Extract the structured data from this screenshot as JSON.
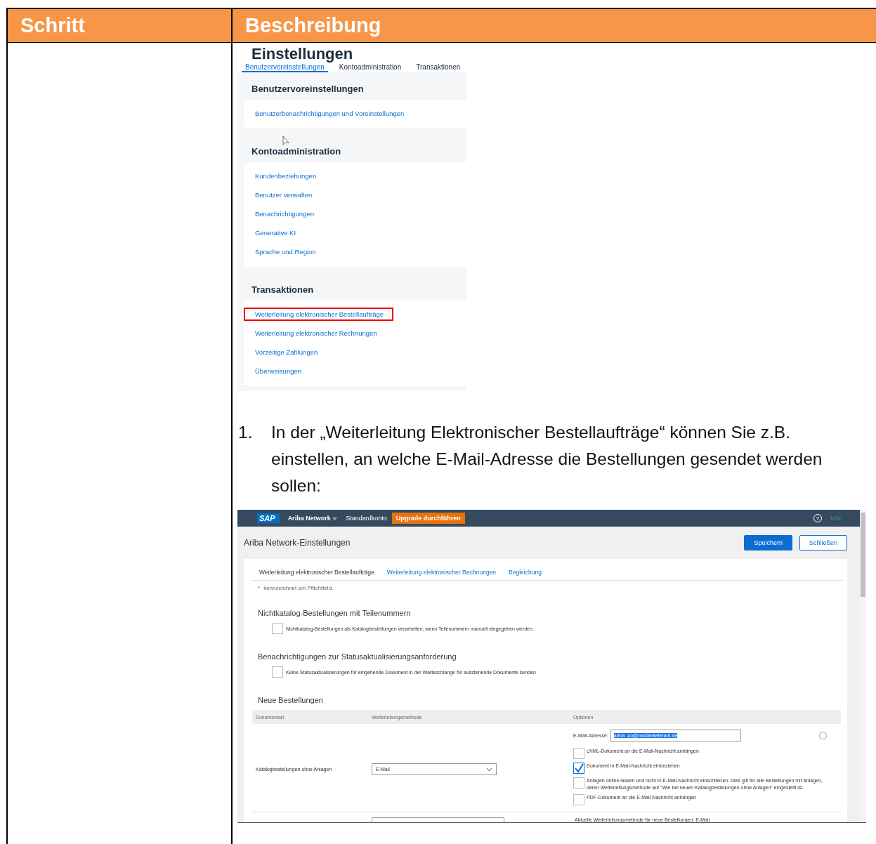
{
  "table": {
    "columns": [
      "Schritt",
      "Beschreibung"
    ]
  },
  "settings_screenshot": {
    "title": "Einstellungen",
    "tabs": [
      {
        "label": "Benutzervoreinstellungen",
        "selected": true
      },
      {
        "label": "Kontoadministration",
        "selected": false
      },
      {
        "label": "Transaktionen",
        "selected": false
      }
    ],
    "sections": [
      {
        "heading": "Benutzervoreinstellungen",
        "links": [
          {
            "label": "Benutzerbenachrichtigungen und Voreinstellungen",
            "highlighted": false
          }
        ]
      },
      {
        "heading": "Kontoadministration",
        "links": [
          {
            "label": "Kundenbeziehungen",
            "highlighted": false
          },
          {
            "label": "Benutzer verwalten",
            "highlighted": false
          },
          {
            "label": "Benachrichtigungen",
            "highlighted": false
          },
          {
            "label": "Generative KI",
            "highlighted": false
          },
          {
            "label": "Sprache und Region",
            "highlighted": false
          }
        ]
      },
      {
        "heading": "Transaktionen",
        "links": [
          {
            "label": "Weiterleitung elektronischer Bestellaufträge",
            "highlighted": true
          },
          {
            "label": "Weiterleitung elektronischer Rechnungen",
            "highlighted": false
          },
          {
            "label": "Vorzeitige Zahlungen",
            "highlighted": false
          },
          {
            "label": "Überweisungen",
            "highlighted": false
          }
        ]
      }
    ]
  },
  "step": {
    "number": "1.",
    "text": "In der „Weiterleitung Elektronischer Bestellaufträge“ können Sie z.B. einstellen, an welche E-Mail-Adresse die Bestellungen gesendet werden sollen:"
  },
  "ariba_screenshot": {
    "top_bar": {
      "logo": "SAP",
      "product": "Ariba Network",
      "account": "Standardkonto",
      "upgrade_button": "Upgrade durchführen",
      "help": "?",
      "avatar": "MM"
    },
    "page_title": "Ariba Network-Einstellungen",
    "buttons": [
      {
        "label": "Speichern",
        "kind": "primary"
      },
      {
        "label": "Schließen",
        "kind": "secondary"
      }
    ],
    "tabs": [
      {
        "label": "Weiterleitung elektronischer Bestellaufträge",
        "selected": true
      },
      {
        "label": "Weiterleitung elektronischer Rechnungen",
        "selected": false
      },
      {
        "label": "Begleichung",
        "selected": false
      }
    ],
    "required_note": {
      "mark": "*",
      "text": "kennzeichnet ein Pflichtfeld."
    },
    "groups": [
      {
        "heading": "Nichtkatalog-Bestellungen mit Teilenummern",
        "option": {
          "label": "Nichtkatalog-Bestellungen als Katalogbestellungen verarbeiten, wenn Teilenummern manuell eingegeben werden.",
          "checked": false
        }
      },
      {
        "heading": "Benachrichtigungen zur Statusaktualisierungsanforderung",
        "option": {
          "label": "Keine Statusaktualisierungen für eingehende Dokument in der Warteschlange für ausstehende Dokumente senden",
          "checked": false
        }
      }
    ],
    "orders": {
      "heading": "Neue Bestellungen",
      "columns": [
        "Dokumentart",
        "Weiterleitungsmethode",
        "Optionen"
      ],
      "row": {
        "document_type": "Katalogbestellungen ohne Anlagen",
        "method": "E-Mail",
        "email_label": "E-Mail-Adresse:",
        "email": "ariba_po@musterlieferant.de",
        "options": [
          {
            "label": "cXML-Dokument an die E-Mail-Nachricht anhängen",
            "checked": false
          },
          {
            "label": "Dokument in E-Mail-Nachricht einbeziehen",
            "checked": true
          },
          {
            "label": "Anlagen online lassen und nicht in E-Mail-Nachricht einschließen.  Dies gilt für alle Bestellungen mit Anlagen, deren Weiterleitungsmethode auf \"Wie bei neuen Katalogbestellungen ohne Anlagen\" eingestellt ist.",
            "checked": false
          },
          {
            "label": "PDF-Dokument an die E-Mail-Nachricht anhängen",
            "checked": false
          }
        ]
      },
      "next_row_note": "Aktuelle Weiterleitungsmethode für neue Bestellungen: E-Mail"
    }
  }
}
